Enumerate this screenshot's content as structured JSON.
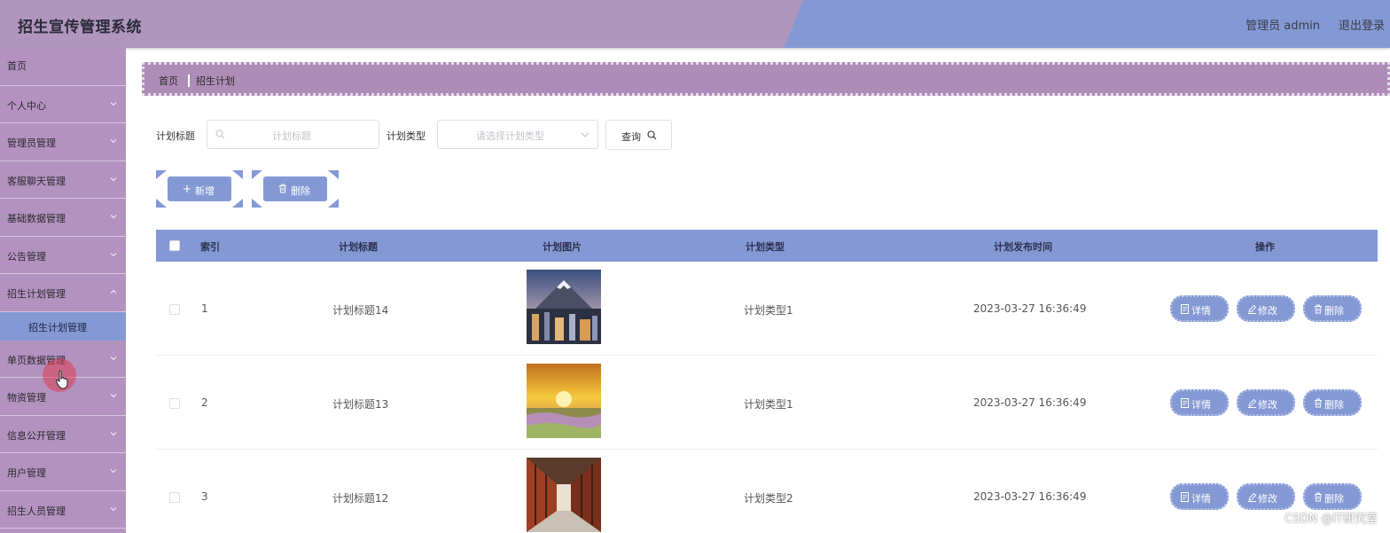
{
  "header": {
    "title": "招生宣传管理系统",
    "user": "管理员 admin",
    "logout": "退出登录",
    "colors": {
      "left": "#b095bd",
      "right": "#8499d4"
    }
  },
  "sidebar": {
    "items": [
      {
        "label": "首页"
      },
      {
        "label": "个人中心"
      },
      {
        "label": "管理员管理"
      },
      {
        "label": "客服聊天管理"
      },
      {
        "label": "基础数据管理"
      },
      {
        "label": "公告管理"
      },
      {
        "label": "招生计划管理"
      },
      {
        "label": "单页数据管理"
      },
      {
        "label": "物资管理"
      },
      {
        "label": "信息公开管理"
      },
      {
        "label": "用户管理"
      },
      {
        "label": "招生人员管理"
      }
    ],
    "submenu": {
      "label": "招生计划管理"
    }
  },
  "breadcrumb": {
    "home": "首页",
    "current": "招生计划"
  },
  "search": {
    "title_label": "计划标题",
    "title_placeholder": "计划标题",
    "type_label": "计划类型",
    "type_placeholder": "请选择计划类型",
    "query": "查询"
  },
  "actions": {
    "add": "新增",
    "delete": "删除"
  },
  "table": {
    "headers": {
      "index": "索引",
      "title": "计划标题",
      "image": "计划图片",
      "type": "计划类型",
      "time": "计划发布时间",
      "ops": "操作"
    },
    "rows": [
      {
        "index": "1",
        "title": "计划标题14",
        "type": "计划类型1",
        "time": "2023-03-27 16:36:49",
        "image": "city-mountain-image"
      },
      {
        "index": "2",
        "title": "计划标题13",
        "type": "计划类型1",
        "time": "2023-03-27 16:36:49",
        "image": "sunset-field-image"
      },
      {
        "index": "3",
        "title": "计划标题12",
        "type": "计划类型2",
        "time": "2023-03-27 16:36:49",
        "image": "corridor-image"
      }
    ],
    "ops": {
      "detail": "详情",
      "edit": "修改",
      "delete": "删除"
    }
  },
  "watermark": "CSDN @IT研究室"
}
